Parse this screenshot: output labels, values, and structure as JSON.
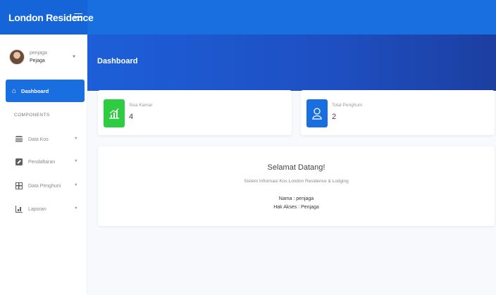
{
  "app": {
    "brand": "London Residence"
  },
  "sidebar": {
    "user": {
      "name": "penjaga",
      "role": "Pejaga"
    },
    "active_item": {
      "label": "Dashboard"
    },
    "section_heading": "COMPONENTS",
    "items": [
      {
        "label": "Data Kos",
        "icon": "layers-icon"
      },
      {
        "label": "Pendaftaran",
        "icon": "edit-icon"
      },
      {
        "label": "Data Penghuni",
        "icon": "table-icon"
      },
      {
        "label": "Laporan",
        "icon": "bar-chart-icon"
      }
    ]
  },
  "header": {
    "title": "Dashboard"
  },
  "stats": [
    {
      "label": "Sisa Kamar",
      "value": "4",
      "color": "#2ecc40",
      "icon": "growth-chart-icon"
    },
    {
      "label": "Total Penghuni",
      "value": "2",
      "color": "#1a6fe0",
      "icon": "user-icon"
    }
  ],
  "welcome": {
    "title": "Selamat Datang!",
    "subtitle": "Sistem Informasi Kos London Residence & Lodging",
    "name_line": "Nama : penjaga",
    "access_line": "Hak Akses : Penjaga"
  },
  "colors": {
    "primary": "#1a6fe0",
    "success": "#2ecc40",
    "page_bg": "#f8f9fc"
  }
}
